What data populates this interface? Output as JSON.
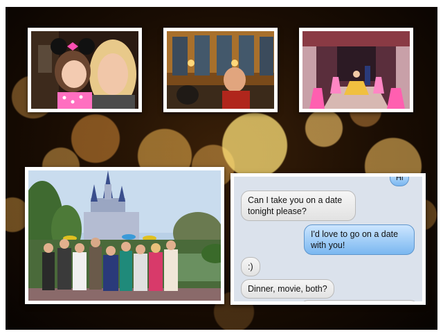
{
  "colors": {
    "frame": "#ffffff",
    "background": "#1a0d03",
    "bokeh": "#ffe178",
    "incoming_bubble": "#e2e2e2",
    "outgoing_bubble": "#7ab7f0",
    "messages_background": "#dbe2ec"
  },
  "photos": [
    {
      "name": "girl-with-minnie-ears-and-woman"
    },
    {
      "name": "man-in-ballroom-restaurant"
    },
    {
      "name": "princess-stage-show"
    },
    {
      "name": "family-group-in-front-of-castle"
    }
  ],
  "messages": [
    {
      "from": "me",
      "text": "Hi"
    },
    {
      "from": "them",
      "text": "Can I take you on a date tonight please?"
    },
    {
      "from": "me",
      "text": "I'd love to go on a date with you!"
    },
    {
      "from": "them",
      "text": ":)"
    },
    {
      "from": "them",
      "text": "Dinner, movie, both?"
    }
  ]
}
